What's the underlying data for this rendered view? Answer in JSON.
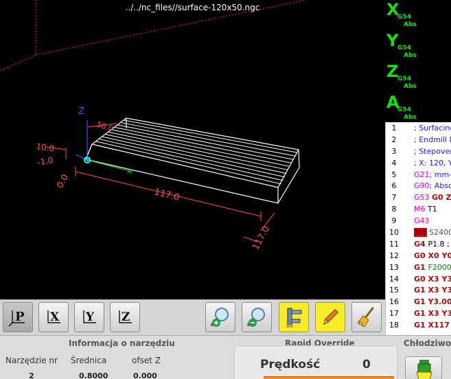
{
  "viewport": {
    "title": "../../nc_files//surface-120x50.ngc",
    "labels": {
      "z_axis": "Z",
      "x_axis": "X",
      "dim_y_small": "50.0",
      "dim_z": "10.0",
      "dim_neg": "-1.0",
      "dim_origin": "0.0",
      "dim_x": "117.0",
      "dim_y": "117.0"
    },
    "colors": {
      "toolpath": "#ffffff",
      "dimensions": "#ff5050",
      "limits": "#ff2020",
      "x_axis": "#20c020",
      "y_axis": "#2060ff",
      "tool": "#20ffff"
    }
  },
  "dro": {
    "axes": [
      {
        "letter": "X",
        "coord": "G54",
        "mode": "Abs"
      },
      {
        "letter": "Y",
        "coord": "G54",
        "mode": "Abs"
      },
      {
        "letter": "Z",
        "coord": "G54",
        "mode": "Abs"
      },
      {
        "letter": "A",
        "coord": "G54",
        "mode": "Abs"
      }
    ],
    "color": "#14e014"
  },
  "gcode": {
    "lines": [
      {
        "num": "1",
        "tokens": [
          {
            "t": "; Surfacing",
            "c": "tk-comment"
          }
        ]
      },
      {
        "num": "2",
        "tokens": [
          {
            "t": "; Endmill D",
            "c": "tk-comment"
          }
        ]
      },
      {
        "num": "3",
        "tokens": [
          {
            "t": "; Stepover",
            "c": "tk-comment"
          }
        ]
      },
      {
        "num": "4",
        "tokens": [
          {
            "t": "; X: 120, Y:",
            "c": "tk-comment"
          }
        ]
      },
      {
        "num": "5",
        "tokens": [
          {
            "t": "G21",
            "c": "tk-gmodal"
          },
          {
            "t": "; mm-",
            "c": "tk-comment"
          }
        ]
      },
      {
        "num": "6",
        "tokens": [
          {
            "t": "G90",
            "c": "tk-gmodal"
          },
          {
            "t": "; Absol",
            "c": "tk-comment"
          }
        ]
      },
      {
        "num": "7",
        "tokens": [
          {
            "t": "G53 ",
            "c": "tk-gmodal"
          },
          {
            "t": "G0 Z0",
            "c": "tk-gmove"
          }
        ]
      },
      {
        "num": "8",
        "tokens": [
          {
            "t": "M6 ",
            "c": "tk-mcode"
          },
          {
            "t": "T1",
            "c": "tk-num"
          }
        ]
      },
      {
        "num": "9",
        "tokens": [
          {
            "t": "G43",
            "c": "tk-gmodal"
          }
        ]
      },
      {
        "num": "10",
        "tokens": [
          {
            "t": "M3",
            "c": "tk-hl"
          },
          {
            "t": " S2400",
            "c": "tk-param"
          }
        ]
      },
      {
        "num": "11",
        "tokens": [
          {
            "t": "G4 ",
            "c": "tk-gmove"
          },
          {
            "t": "P1.8 ; W",
            "c": "tk-num"
          }
        ]
      },
      {
        "num": "12",
        "tokens": [
          {
            "t": "G0 X0 Y0",
            "c": "tk-gmove"
          }
        ]
      },
      {
        "num": "13",
        "tokens": [
          {
            "t": "G1 ",
            "c": "tk-gmove"
          },
          {
            "t": "F2000",
            "c": "tk-feed"
          }
        ]
      },
      {
        "num": "14",
        "tokens": [
          {
            "t": "G0 X3 Y3",
            "c": "tk-gmove"
          }
        ]
      },
      {
        "num": "15",
        "tokens": [
          {
            "t": "G1 X3 Y3",
            "c": "tk-gmove"
          }
        ]
      },
      {
        "num": "16",
        "tokens": [
          {
            "t": "G1 Y3.000",
            "c": "tk-gmove"
          }
        ]
      },
      {
        "num": "17",
        "tokens": [
          {
            "t": "G1 X3 Y3.",
            "c": "tk-gmove"
          }
        ]
      },
      {
        "num": "18",
        "tokens": [
          {
            "t": "G1 X117 Y",
            "c": "tk-gmove"
          }
        ]
      }
    ]
  },
  "toolbar": {
    "view_buttons": [
      {
        "id": "p",
        "label": "P",
        "active": true
      },
      {
        "id": "x",
        "label": "X",
        "active": false
      },
      {
        "id": "y",
        "label": "Y",
        "active": false
      },
      {
        "id": "z",
        "label": "Z",
        "active": false
      }
    ],
    "action_buttons": [
      {
        "id": "zoom-in",
        "icon": "zoom-in-icon"
      },
      {
        "id": "zoom-out",
        "icon": "zoom-out-icon"
      },
      {
        "id": "tool-touch-off",
        "icon": "caliper-icon"
      },
      {
        "id": "edit",
        "icon": "pencil-icon"
      },
      {
        "id": "clear-plot",
        "icon": "broom-icon"
      }
    ]
  },
  "tool_info": {
    "title": "Informacja o narzędziu",
    "headers": [
      "Narzędzie nr",
      "Średnica",
      "ofset Z"
    ],
    "values": [
      "2",
      "0.8000",
      "0.000"
    ]
  },
  "rapid_override": {
    "title": "Rapid Override",
    "speed_label": "Prędkość",
    "speed_value": "0",
    "fill_percent": 100
  },
  "coolant": {
    "title": "Chłodziwo",
    "icon": "coolant-icon"
  }
}
